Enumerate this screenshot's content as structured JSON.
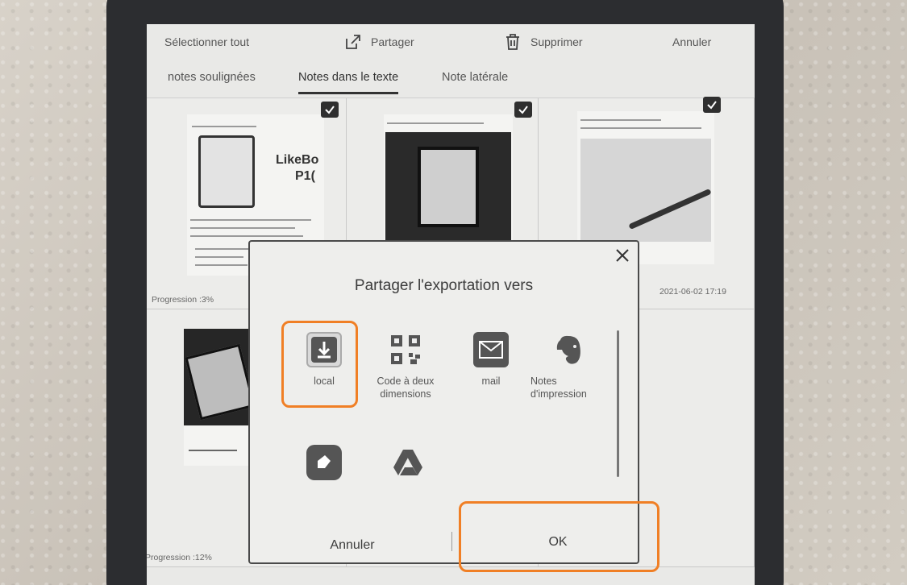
{
  "topbar": {
    "select_all": "Sélectionner tout",
    "share": "Partager",
    "delete": "Supprimer",
    "cancel": "Annuler"
  },
  "tabs": [
    {
      "label": "notes soulignées",
      "active": false
    },
    {
      "label": "Notes dans le texte",
      "active": true
    },
    {
      "label": "Note latérale",
      "active": false
    }
  ],
  "cards": {
    "first": {
      "progress": "Progression :3%",
      "thumb_title": "LikeBo",
      "thumb_sub": "P1("
    },
    "third": {
      "date": "2021-06-02 17:19"
    },
    "fourth": {
      "progress": "Progression :12%"
    }
  },
  "dialog": {
    "title": "Partager l'exportation vers",
    "options": [
      {
        "label": "local",
        "icon": "download-icon"
      },
      {
        "label": "Code à deux dimensions",
        "icon": "qr-code-icon"
      },
      {
        "label": "mail",
        "icon": "mail-icon"
      },
      {
        "label": "Notes d'impression",
        "icon": "evernote-icon"
      },
      {
        "label": "",
        "icon": "onenote-icon"
      },
      {
        "label": "",
        "icon": "google-drive-icon"
      }
    ],
    "cancel": "Annuler",
    "ok": "OK"
  },
  "colors": {
    "highlight": "#f07f25",
    "checkbox": "#2f2f2f",
    "screen": "#e9e9e7"
  }
}
